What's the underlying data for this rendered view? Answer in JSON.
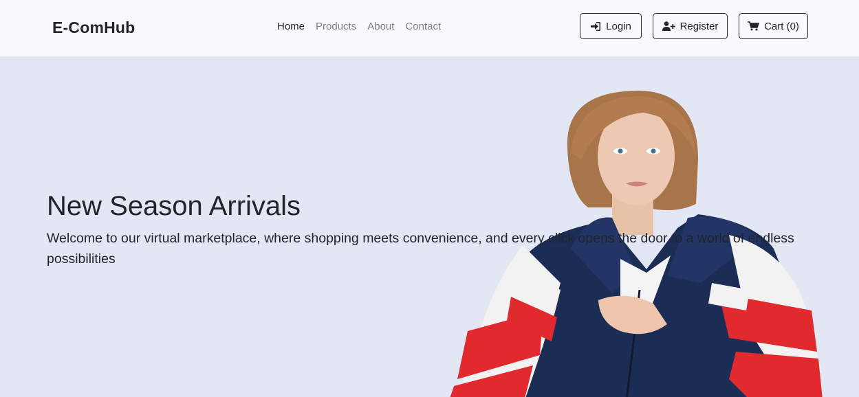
{
  "navbar": {
    "brand": "E-ComHub",
    "links": [
      {
        "label": "Home",
        "active": true
      },
      {
        "label": "Products",
        "active": false
      },
      {
        "label": "About",
        "active": false
      },
      {
        "label": "Contact",
        "active": false
      }
    ],
    "buttons": {
      "login": {
        "label": "Login",
        "icon": "sign-in-icon"
      },
      "register": {
        "label": "Register",
        "icon": "user-plus-icon"
      },
      "cart": {
        "label": "Cart (0)",
        "icon": "cart-icon"
      }
    }
  },
  "hero": {
    "title": "New Season Arrivals",
    "text": "Welcome to our virtual marketplace, where shopping meets convenience, and every click opens the door to a world of endless possibilities",
    "image": "model-in-red-white-navy-jacket"
  },
  "colors": {
    "navbar_bg": "#f8f9fa",
    "hero_bg": "#e3e6f3",
    "text_dark": "#212529",
    "link_muted": "#7b7f84",
    "jacket_navy": "#1c2d55",
    "jacket_red": "#e02a2e"
  }
}
